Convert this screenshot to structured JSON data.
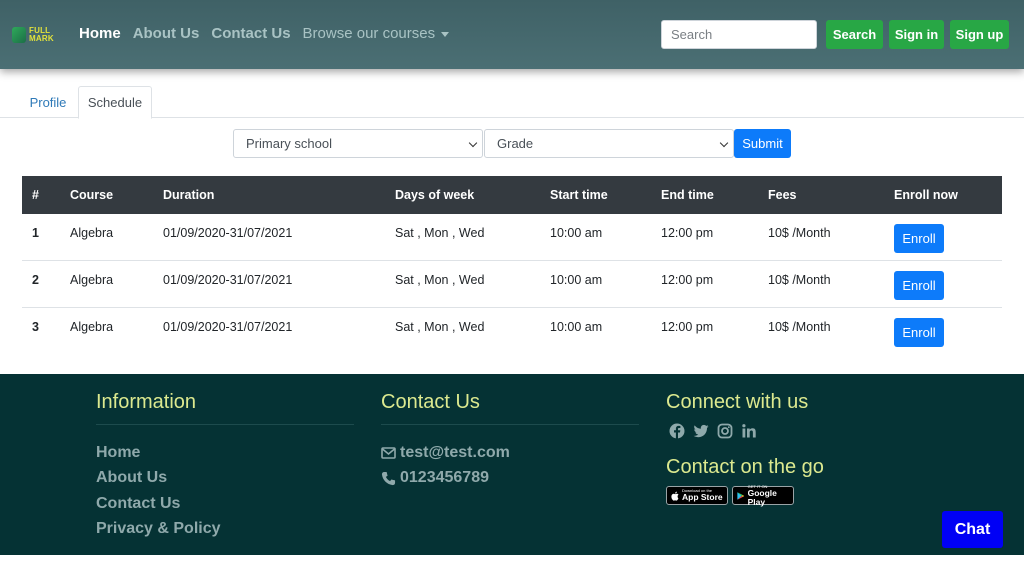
{
  "nav": {
    "logo_line1": "FULL",
    "logo_line2": "MARK",
    "links": [
      "Home",
      "About Us",
      "Contact Us"
    ],
    "dropdown_label": "Browse our courses",
    "search_placeholder": "Search",
    "search_button": "Search",
    "signin_button": "Sign in",
    "signup_button": "Sign up"
  },
  "tabs": [
    "Profile",
    "Schedule"
  ],
  "filter": {
    "school_value": "Primary school",
    "grade_value": "Grade",
    "submit_label": "Submit"
  },
  "table": {
    "headers": [
      "#",
      "Course",
      "Duration",
      "Days of week",
      "Start time",
      "End time",
      "Fees",
      "Enroll now"
    ],
    "rows": [
      {
        "idx": "1",
        "course": "Algebra",
        "duration": "01/09/2020-31/07/2021",
        "days": "Sat , Mon , Wed",
        "start": "10:00 am",
        "end": "12:00 pm",
        "fees": "10$ /Month",
        "action": "Enroll"
      },
      {
        "idx": "2",
        "course": "Algebra",
        "duration": "01/09/2020-31/07/2021",
        "days": "Sat , Mon , Wed",
        "start": "10:00 am",
        "end": "12:00 pm",
        "fees": "10$ /Month",
        "action": "Enroll"
      },
      {
        "idx": "3",
        "course": "Algebra",
        "duration": "01/09/2020-31/07/2021",
        "days": "Sat , Mon , Wed",
        "start": "10:00 am",
        "end": "12:00 pm",
        "fees": "10$ /Month",
        "action": "Enroll"
      }
    ]
  },
  "footer": {
    "info_title": "Information",
    "info_links": [
      "Home",
      "About Us",
      "Contact Us",
      "Privacy & Policy"
    ],
    "contact_title": "Contact Us",
    "email": "test@test.com",
    "phone": "0123456789",
    "connect_title": "Connect with us",
    "social_icons": [
      "facebook-icon",
      "twitter-icon",
      "instagram-icon",
      "linkedin-icon"
    ],
    "go_title": "Contact on the go",
    "app_store_small": "Download on the",
    "app_store_big": "App Store",
    "google_play_small": "GET IT ON",
    "google_play_big": "Google Play"
  },
  "chat_label": "Chat",
  "colors": {
    "navbar": "#46676b",
    "green_button": "#28a745",
    "primary_button": "#0d7bfa",
    "table_header": "#343a40",
    "footer": "#053234",
    "footer_title": "#dce98f",
    "chat": "#0000f5"
  }
}
